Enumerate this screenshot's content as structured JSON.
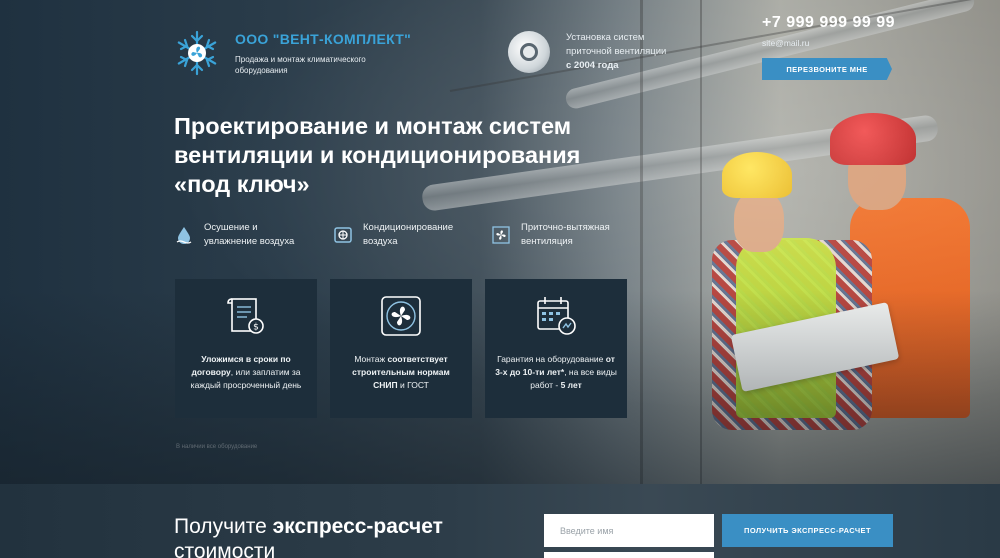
{
  "header": {
    "company_name": "ООО \"ВЕНТ-КОМПЛЕКТ\"",
    "company_desc": "Продажа и монтаж климатического оборудования",
    "since_line1": "Установка систем",
    "since_line2": "приточной вентиляции",
    "since_line3": "с 2004 года",
    "phone": "+7 999 999 99 99",
    "email": "site@mail.ru",
    "callback_label": "ПЕРЕЗВОНИТЕ МНЕ"
  },
  "hero": {
    "headline_line1": "Проектирование и монтаж систем",
    "headline_line2": "вентиляции и кондиционирования",
    "headline_line3": "«под ключ»",
    "photo_caption": "В наличии все оборудование"
  },
  "features": [
    {
      "line1": "Осушение и",
      "line2": "увлажнение воздуха",
      "icon": "humidity-icon"
    },
    {
      "line1": "Кондиционирование",
      "line2": "воздуха",
      "icon": "air-conditioner-icon"
    },
    {
      "line1": "Приточно-вытяжная",
      "line2": "вентиляция",
      "icon": "fan-icon"
    }
  ],
  "cards": [
    {
      "icon": "contract-icon",
      "bold1": "Уложимся в сроки по",
      "bold2": "договору",
      "rest": ", или заплатим за каждый просроченный день"
    },
    {
      "icon": "fan-box-icon",
      "pre": "Монтаж",
      "bold": "соответствует строительным нормам СНИП",
      "post": " и ГОСТ"
    },
    {
      "icon": "calendar-icon",
      "pre": "Гарантия на оборудование ",
      "bold": "от 3-х до 10-ти лет*",
      "mid": ", на все виды работ - ",
      "bold2": "5 лет"
    }
  ],
  "bottom": {
    "title_normal": "Получите ",
    "title_bold": "экспресс-расчет",
    "title_end": " стоимости",
    "name_placeholder": "Введите имя",
    "submit_label": "ПОЛУЧИТЬ ЭКСПРЕСС-РАСЧЕТ"
  },
  "colors": {
    "accent": "#3a8fc4",
    "brand_text": "#3aa3d8",
    "card_bg": "#1d2e3b",
    "dark_bg": "#24333f"
  }
}
